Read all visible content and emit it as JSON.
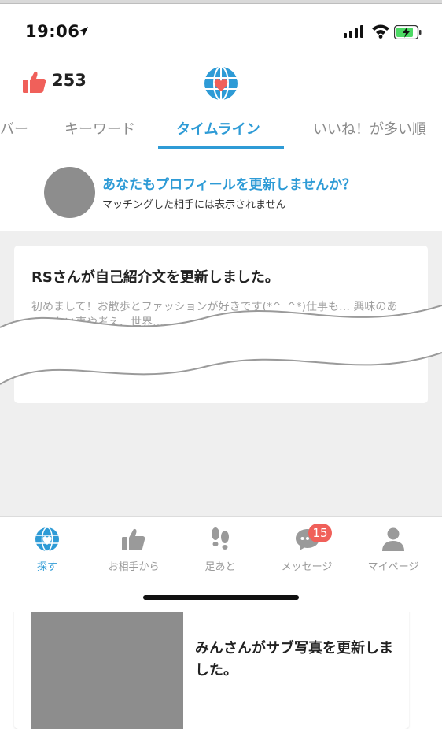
{
  "status_bar": {
    "time": "19:06"
  },
  "header": {
    "like_count": "253"
  },
  "tabs": [
    {
      "label": "バー",
      "active": false
    },
    {
      "label": "キーワード",
      "active": false
    },
    {
      "label": "タイムライン",
      "active": true
    },
    {
      "label": "いいね！が多い順",
      "active": false
    }
  ],
  "prompt": {
    "title": "あなたもプロフィールを更新しませんか？",
    "subtitle": "マッチングした相手には表示されません"
  },
  "feed": {
    "card1": {
      "title": "RSさんが自己紹介文を更新しました。",
      "body": "初めまして！お散歩とファッションが好きです(*^_^*)仕事も… 興味のある…たい事や考え、世界…"
    },
    "card2": {
      "title": "みんさんがサブ写真を更新しました。"
    }
  },
  "bottom_nav": [
    {
      "label": "探す",
      "icon": "globe-heart-icon",
      "active": true
    },
    {
      "label": "お相手から",
      "icon": "thumbs-up-icon",
      "active": false
    },
    {
      "label": "足あと",
      "icon": "footprints-icon",
      "active": false
    },
    {
      "label": "メッセージ",
      "icon": "chat-bubble-icon",
      "active": false,
      "badge": "15"
    },
    {
      "label": "マイページ",
      "icon": "person-icon",
      "active": false
    }
  ],
  "colors": {
    "accent": "#2e9bd6",
    "like": "#f0605a",
    "badge": "#f0605a",
    "placeholder": "#8d8d8d",
    "feed_background": "#efefef"
  }
}
